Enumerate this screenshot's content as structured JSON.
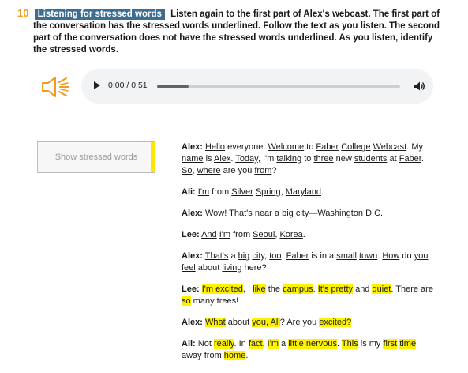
{
  "exercise": {
    "number": "10",
    "title": "Listening for stressed words",
    "instructions": "Listen again to the first part of Alex's webcast. The first part of the conversation has the stressed words underlined. Follow the text as you listen. The second part of the conversation does not have the stressed words underlined. As you listen, identify the stressed words."
  },
  "audio": {
    "current_time": "0:00",
    "duration": "0:51",
    "time_display": "0:00 / 0:51",
    "progress": 0
  },
  "controls": {
    "show_stressed_label": "Show stressed words"
  },
  "colors": {
    "accent_orange": "#f39a1f",
    "title_bg": "#3d6d91",
    "highlight": "#fff200"
  },
  "transcript": [
    {
      "speaker": "Alex:",
      "segments": [
        {
          "t": "Hello",
          "s": "u"
        },
        {
          "t": " everyone. "
        },
        {
          "t": "Welcome",
          "s": "u"
        },
        {
          "t": " to "
        },
        {
          "t": "Faber",
          "s": "u"
        },
        {
          "t": " "
        },
        {
          "t": "College",
          "s": "u"
        },
        {
          "t": " "
        },
        {
          "t": "Webcast",
          "s": "u"
        },
        {
          "t": ". My "
        },
        {
          "t": "name",
          "s": "u"
        },
        {
          "t": " is "
        },
        {
          "t": "Alex",
          "s": "u"
        },
        {
          "t": ". "
        },
        {
          "t": "Today",
          "s": "u"
        },
        {
          "t": ", I'm "
        },
        {
          "t": "talking",
          "s": "u"
        },
        {
          "t": " to "
        },
        {
          "t": "three",
          "s": "u"
        },
        {
          "t": " new "
        },
        {
          "t": "students",
          "s": "u"
        },
        {
          "t": " at "
        },
        {
          "t": "Faber",
          "s": "u"
        },
        {
          "t": ". "
        },
        {
          "t": "So",
          "s": "u"
        },
        {
          "t": ", "
        },
        {
          "t": "where",
          "s": "u"
        },
        {
          "t": " are you "
        },
        {
          "t": "from",
          "s": "u"
        },
        {
          "t": "?"
        }
      ]
    },
    {
      "speaker": "Ali:",
      "segments": [
        {
          "t": "I'm",
          "s": "u"
        },
        {
          "t": " from "
        },
        {
          "t": "Silver",
          "s": "u"
        },
        {
          "t": " "
        },
        {
          "t": "Spring",
          "s": "u"
        },
        {
          "t": ", "
        },
        {
          "t": "Maryland",
          "s": "u"
        },
        {
          "t": "."
        }
      ]
    },
    {
      "speaker": "Alex:",
      "segments": [
        {
          "t": "Wow",
          "s": "u"
        },
        {
          "t": "! "
        },
        {
          "t": "That's",
          "s": "u"
        },
        {
          "t": " near a "
        },
        {
          "t": "big",
          "s": "u"
        },
        {
          "t": " "
        },
        {
          "t": "city",
          "s": "u"
        },
        {
          "t": "—"
        },
        {
          "t": "Washington",
          "s": "u"
        },
        {
          "t": " "
        },
        {
          "t": "D.C",
          "s": "u"
        },
        {
          "t": "."
        }
      ]
    },
    {
      "speaker": "Lee:",
      "segments": [
        {
          "t": "And",
          "s": "u"
        },
        {
          "t": " "
        },
        {
          "t": "I'm",
          "s": "u"
        },
        {
          "t": " from "
        },
        {
          "t": "Seoul",
          "s": "u"
        },
        {
          "t": ", "
        },
        {
          "t": "Korea",
          "s": "u"
        },
        {
          "t": "."
        }
      ]
    },
    {
      "speaker": "Alex:",
      "segments": [
        {
          "t": "That's",
          "s": "u"
        },
        {
          "t": " a "
        },
        {
          "t": "big",
          "s": "u"
        },
        {
          "t": " "
        },
        {
          "t": "city",
          "s": "u"
        },
        {
          "t": ", "
        },
        {
          "t": "too",
          "s": "u"
        },
        {
          "t": ". "
        },
        {
          "t": "Faber",
          "s": "u"
        },
        {
          "t": " is in a "
        },
        {
          "t": "small",
          "s": "u"
        },
        {
          "t": " "
        },
        {
          "t": "town",
          "s": "u"
        },
        {
          "t": ". "
        },
        {
          "t": "How",
          "s": "u"
        },
        {
          "t": " do "
        },
        {
          "t": "you",
          "s": "u"
        },
        {
          "t": " "
        },
        {
          "t": "feel",
          "s": "u"
        },
        {
          "t": " about "
        },
        {
          "t": "living",
          "s": "u"
        },
        {
          "t": " here?"
        }
      ]
    },
    {
      "speaker": "Lee:",
      "segments": [
        {
          "t": "I'm excited",
          "s": "h"
        },
        {
          "t": ", I "
        },
        {
          "t": "like",
          "s": "h"
        },
        {
          "t": " the "
        },
        {
          "t": "campus",
          "s": "h"
        },
        {
          "t": ". "
        },
        {
          "t": "It's pretty",
          "s": "h"
        },
        {
          "t": " and "
        },
        {
          "t": "quiet",
          "s": "h"
        },
        {
          "t": ". There are "
        },
        {
          "t": "so",
          "s": "h"
        },
        {
          "t": " many trees!"
        }
      ]
    },
    {
      "speaker": "Alex:",
      "segments": [
        {
          "t": "What",
          "s": "h"
        },
        {
          "t": " about "
        },
        {
          "t": "you, Ali",
          "s": "h"
        },
        {
          "t": "? Are you "
        },
        {
          "t": "excited?",
          "s": "h"
        }
      ]
    },
    {
      "speaker": "Ali:",
      "segments": [
        {
          "t": "Not "
        },
        {
          "t": "really",
          "s": "h"
        },
        {
          "t": ". In "
        },
        {
          "t": "fact",
          "s": "h"
        },
        {
          "t": ", "
        },
        {
          "t": "I'm",
          "s": "h"
        },
        {
          "t": " a "
        },
        {
          "t": "little nervous",
          "s": "h"
        },
        {
          "t": ". "
        },
        {
          "t": "This",
          "s": "h"
        },
        {
          "t": " is my "
        },
        {
          "t": "first",
          "s": "h"
        },
        {
          "t": " "
        },
        {
          "t": "time",
          "s": "h"
        },
        {
          "t": " away from "
        },
        {
          "t": "home",
          "s": "h"
        },
        {
          "t": "."
        }
      ]
    }
  ],
  "icons": {
    "speaker": "speaker-icon",
    "play": "play-icon",
    "volume": "volume-icon"
  }
}
